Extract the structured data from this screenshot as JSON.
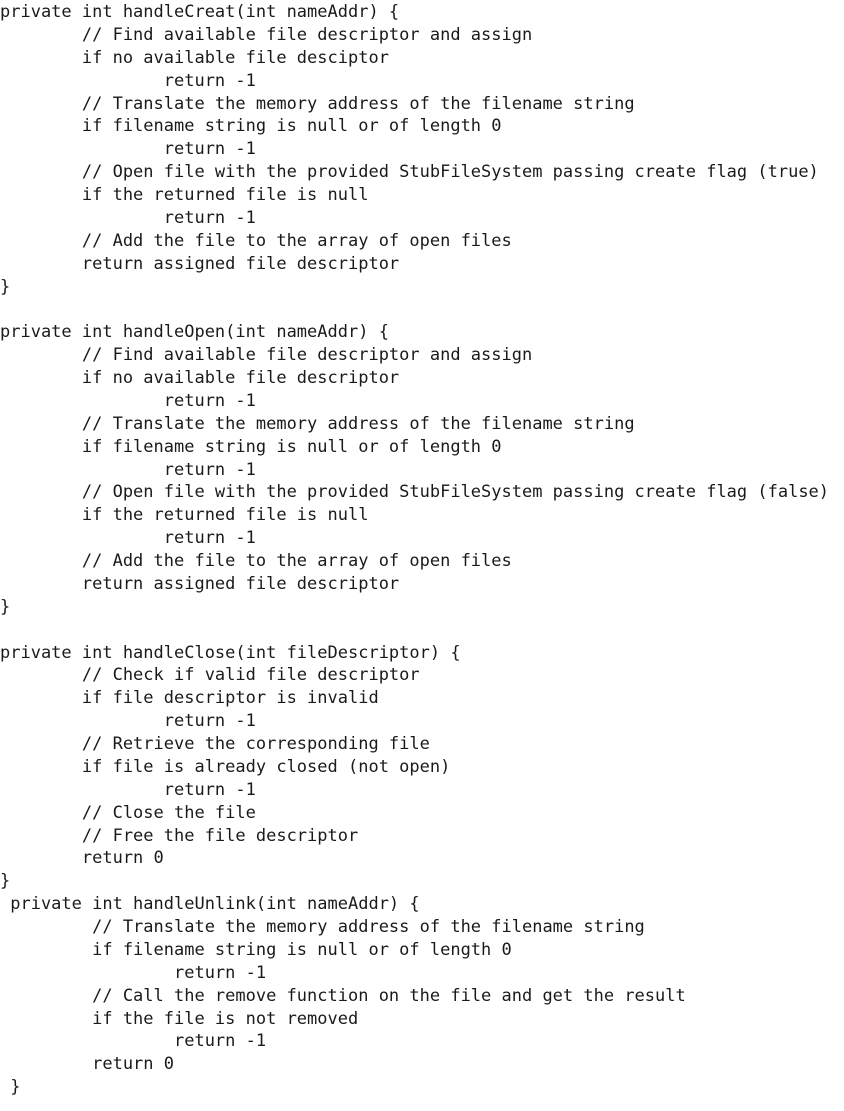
{
  "document": {
    "lines": [
      "private int handleCreat(int nameAddr) {",
      "        // Find available file descriptor and assign",
      "        if no available file desciptor",
      "                return -1",
      "        // Translate the memory address of the filename string",
      "        if filename string is null or of length 0",
      "                return -1",
      "        // Open file with the provided StubFileSystem passing create flag (true)",
      "        if the returned file is null",
      "                return -1",
      "        // Add the file to the array of open files",
      "        return assigned file descriptor",
      "}",
      "",
      "private int handleOpen(int nameAddr) {",
      "        // Find available file descriptor and assign",
      "        if no available file descriptor",
      "                return -1",
      "        // Translate the memory address of the filename string",
      "        if filename string is null or of length 0",
      "                return -1",
      "        // Open file with the provided StubFileSystem passing create flag (false)",
      "        if the returned file is null",
      "                return -1",
      "        // Add the file to the array of open files",
      "        return assigned file descriptor",
      "}",
      "",
      "private int handleClose(int fileDescriptor) {",
      "        // Check if valid file descriptor",
      "        if file descriptor is invalid",
      "                return -1",
      "        // Retrieve the corresponding file",
      "        if file is already closed (not open)",
      "                return -1",
      "        // Close the file",
      "        // Free the file descriptor",
      "        return 0",
      "}",
      " private int handleUnlink(int nameAddr) {",
      "         // Translate the memory address of the filename string",
      "         if filename string is null or of length 0",
      "                 return -1",
      "         // Call the remove function on the file and get the result",
      "         if the file is not removed",
      "                 return -1",
      "         return 0",
      " }"
    ]
  }
}
